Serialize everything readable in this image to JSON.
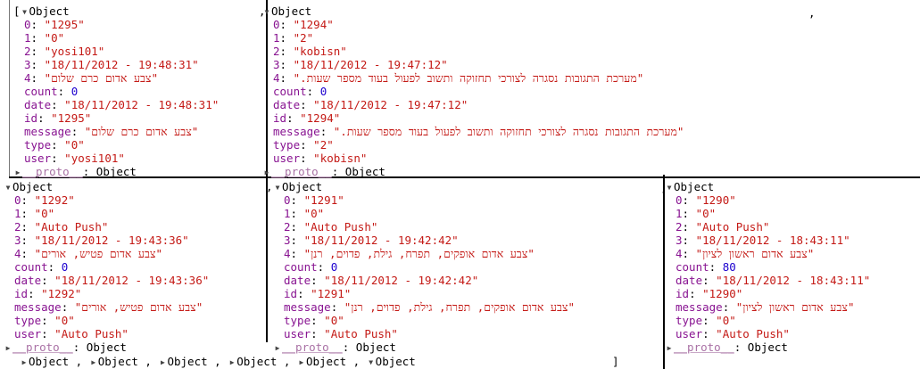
{
  "panels": [
    {
      "name": "obj-1295",
      "prefix": "[",
      "header": "Object",
      "trailing_comma": ",",
      "rows": [
        {
          "k": "0",
          "v": "\"1295\"",
          "t": "str"
        },
        {
          "k": "1",
          "v": "\"0\"",
          "t": "str"
        },
        {
          "k": "2",
          "v": "\"yosi101\"",
          "t": "str"
        },
        {
          "k": "3",
          "v": "\"18/11/2012 - 19:48:31\"",
          "t": "str"
        },
        {
          "k": "4",
          "v": "\"צבע אדום כרם שלום\"",
          "t": "str"
        },
        {
          "k": "count",
          "v": "0",
          "t": "num"
        },
        {
          "k": "date",
          "v": "\"18/11/2012 - 19:48:31\"",
          "t": "str"
        },
        {
          "k": "id",
          "v": "\"1295\"",
          "t": "str"
        },
        {
          "k": "message",
          "v": "\"צבע אדום כרם שלום\"",
          "t": "str"
        },
        {
          "k": "type",
          "v": "\"0\"",
          "t": "str"
        },
        {
          "k": "user",
          "v": "\"yosi101\"",
          "t": "str"
        }
      ],
      "proto": "__proto__",
      "proto_value": "Object"
    },
    {
      "name": "obj-1294",
      "prefix": "",
      "header": "Object",
      "trailing_comma": ",",
      "rows": [
        {
          "k": "0",
          "v": "\"1294\"",
          "t": "str"
        },
        {
          "k": "1",
          "v": "\"2\"",
          "t": "str"
        },
        {
          "k": "2",
          "v": "\"kobisn\"",
          "t": "str"
        },
        {
          "k": "3",
          "v": "\"18/11/2012 - 19:47:12\"",
          "t": "str"
        },
        {
          "k": "4",
          "v": "\".מערכת התגובות נסגרה לצורכי תחזוקה ותשוב לפעול בעוד מספר שעות\"",
          "t": "str"
        },
        {
          "k": "count",
          "v": "0",
          "t": "num"
        },
        {
          "k": "date",
          "v": "\"18/11/2012 - 19:47:12\"",
          "t": "str"
        },
        {
          "k": "id",
          "v": "\"1294\"",
          "t": "str"
        },
        {
          "k": "message",
          "v": "\".מערכת התגובות נסגרה לצורכי תחזוקה ותשוב לפעול בעוד מספר שעות\"",
          "t": "str"
        },
        {
          "k": "type",
          "v": "\"2\"",
          "t": "str"
        },
        {
          "k": "user",
          "v": "\"kobisn\"",
          "t": "str"
        }
      ],
      "proto": "__proto__",
      "proto_value": "Object"
    },
    {
      "name": "obj-1292",
      "prefix": "",
      "header": "Object",
      "trailing_comma": ",",
      "rows": [
        {
          "k": "0",
          "v": "\"1292\"",
          "t": "str"
        },
        {
          "k": "1",
          "v": "\"0\"",
          "t": "str"
        },
        {
          "k": "2",
          "v": "\"Auto Push\"",
          "t": "str"
        },
        {
          "k": "3",
          "v": "\"18/11/2012 - 19:43:36\"",
          "t": "str"
        },
        {
          "k": "4",
          "v": "\"צבע אדום פטיש, אורים\"",
          "t": "str"
        },
        {
          "k": "count",
          "v": "0",
          "t": "num"
        },
        {
          "k": "date",
          "v": "\"18/11/2012 - 19:43:36\"",
          "t": "str"
        },
        {
          "k": "id",
          "v": "\"1292\"",
          "t": "str"
        },
        {
          "k": "message",
          "v": "\"צבע אדום פטיש, אורים\"",
          "t": "str"
        },
        {
          "k": "type",
          "v": "\"0\"",
          "t": "str"
        },
        {
          "k": "user",
          "v": "\"Auto Push\"",
          "t": "str"
        }
      ],
      "proto": "__proto__",
      "proto_value": "Object"
    },
    {
      "name": "obj-1291",
      "prefix": "",
      "header": "Object",
      "trailing_comma": "",
      "rows": [
        {
          "k": "0",
          "v": "\"1291\"",
          "t": "str"
        },
        {
          "k": "1",
          "v": "\"0\"",
          "t": "str"
        },
        {
          "k": "2",
          "v": "\"Auto Push\"",
          "t": "str"
        },
        {
          "k": "3",
          "v": "\"18/11/2012 - 19:42:42\"",
          "t": "str"
        },
        {
          "k": "4",
          "v": "\"צבע אדום אופקים, תפרח, גילת, פדוים, רנן\"",
          "t": "str"
        },
        {
          "k": "count",
          "v": "0",
          "t": "num"
        },
        {
          "k": "date",
          "v": "\"18/11/2012 - 19:42:42\"",
          "t": "str"
        },
        {
          "k": "id",
          "v": "\"1291\"",
          "t": "str"
        },
        {
          "k": "message",
          "v": "\"צבע אדום אופקים, תפרח, גילת, פדוים, רנן\"",
          "t": "str"
        },
        {
          "k": "type",
          "v": "\"0\"",
          "t": "str"
        },
        {
          "k": "user",
          "v": "\"Auto Push\"",
          "t": "str"
        }
      ],
      "proto": "__proto__",
      "proto_value": "Object"
    },
    {
      "name": "obj-1290",
      "prefix": "",
      "header": "Object",
      "trailing_comma": "",
      "rows": [
        {
          "k": "0",
          "v": "\"1290\"",
          "t": "str"
        },
        {
          "k": "1",
          "v": "\"0\"",
          "t": "str"
        },
        {
          "k": "2",
          "v": "\"Auto Push\"",
          "t": "str"
        },
        {
          "k": "3",
          "v": "\"18/11/2012 - 18:43:11\"",
          "t": "str"
        },
        {
          "k": "4",
          "v": "\"צבע אדום ראשון לציון\"",
          "t": "str"
        },
        {
          "k": "count",
          "v": "80",
          "t": "num"
        },
        {
          "k": "date",
          "v": "\"18/11/2012 - 18:43:11\"",
          "t": "str"
        },
        {
          "k": "id",
          "v": "\"1290\"",
          "t": "str"
        },
        {
          "k": "message",
          "v": "\"צבע אדום ראשון לציון\"",
          "t": "str"
        },
        {
          "k": "type",
          "v": "\"0\"",
          "t": "str"
        },
        {
          "k": "user",
          "v": "\"Auto Push\"",
          "t": "str"
        }
      ],
      "proto": "__proto__",
      "proto_value": "Object"
    }
  ],
  "summary": {
    "items": [
      "Object",
      "Object",
      "Object",
      "Object",
      "Object",
      "Object"
    ],
    "separator": ",",
    "closing": "]"
  },
  "glyphs": {
    "expanded": "▼",
    "collapsed": "▶"
  },
  "stray_commas": [
    ",",
    ","
  ]
}
